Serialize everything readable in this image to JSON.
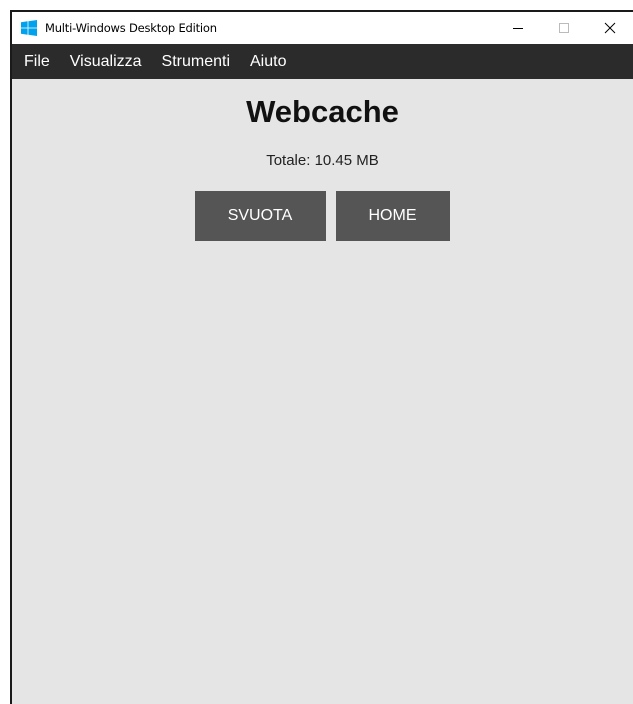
{
  "window": {
    "title": "Multi-Windows Desktop Edition",
    "icon": "windows-logo-icon",
    "accent_color": "#00a2ed",
    "controls": {
      "minimize": "–",
      "maximize": "□",
      "close": "✕"
    }
  },
  "menubar": {
    "items": [
      {
        "label": "File"
      },
      {
        "label": "Visualizza"
      },
      {
        "label": "Strumenti"
      },
      {
        "label": "Aiuto"
      }
    ]
  },
  "main": {
    "title": "Webcache",
    "total": "Totale: 10.45 MB",
    "buttons": {
      "clear_label": "SVUOTA",
      "home_label": "HOME"
    }
  }
}
